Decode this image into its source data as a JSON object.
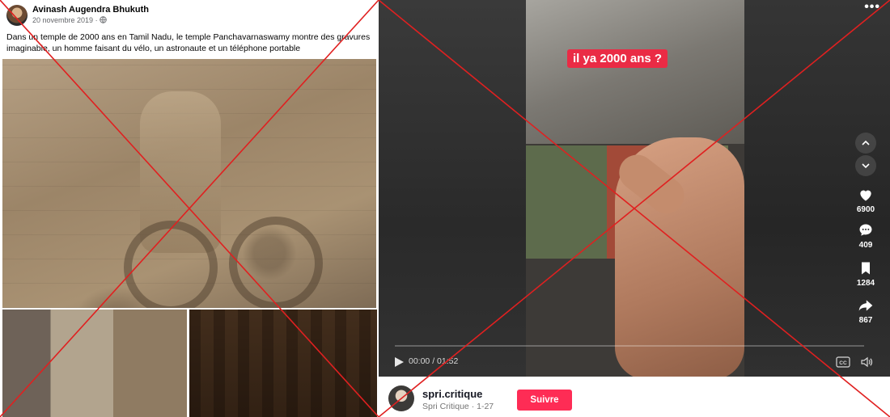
{
  "facebook_post": {
    "author": "Avinash Augendra Bhukuth",
    "date": "20 novembre 2019",
    "date_separator": " · ",
    "audience_icon": "globe-icon",
    "text": "Dans un temple de 2000 ans en Tamil Nadu, le temple Panchavarnaswamy montre des gravures imaginable, un homme faisant du vélo, un astronaute et un téléphone portable"
  },
  "tiktok": {
    "overlay_caption": "il ya 2000 ans ?",
    "more_icon": "more-dots-icon",
    "more_label": "•••",
    "actions": [
      {
        "icon": "heart-icon",
        "count": "6900"
      },
      {
        "icon": "comment-icon",
        "count": "409"
      },
      {
        "icon": "bookmark-icon",
        "count": "1284"
      },
      {
        "icon": "share-icon",
        "count": "867"
      }
    ],
    "player": {
      "time": "00:00 / 01:52",
      "progress": 0
    },
    "author": {
      "handle": "spri.critique",
      "subtitle": "Spri Critique · 1-27",
      "follow_label": "Suivre"
    }
  },
  "colors": {
    "cross_marks": "#e02020",
    "follow_button": "#fe2c55",
    "caption_background": "#ea2b45"
  }
}
